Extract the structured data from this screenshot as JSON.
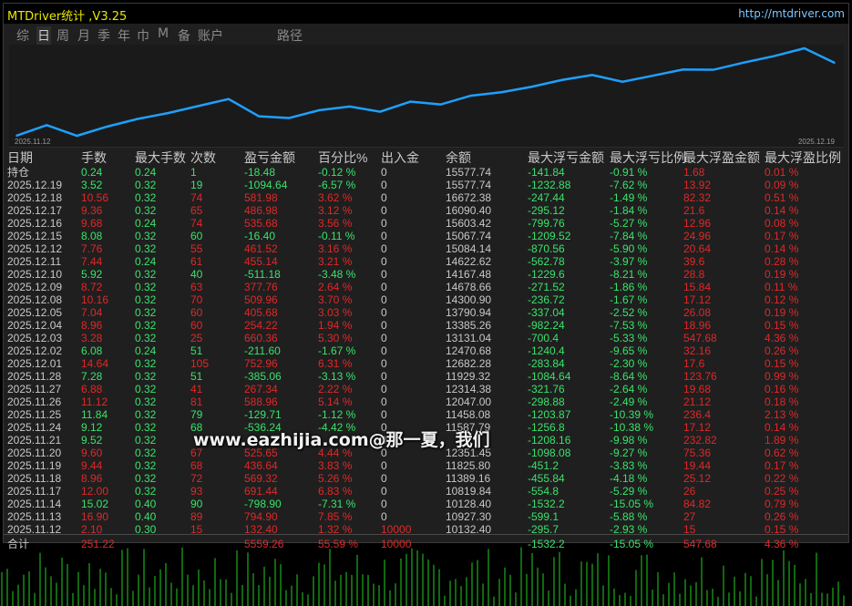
{
  "app": {
    "title": "MTDriver统计 ,V3.25",
    "url": "http://mtdriver.com"
  },
  "tabs": [
    "综",
    "日",
    "周",
    "月",
    "季",
    "年",
    "巾",
    "M",
    "备",
    "账户",
    "路径"
  ],
  "active_tab": "日",
  "chart_data": {
    "type": "line",
    "x_start_label": "2025.11.12",
    "x_end_label": "2025.12.19",
    "series": [
      {
        "values": [
          10132.4,
          10927.3,
          10128.4,
          10819.84,
          11389.16,
          11825.8,
          12351.45,
          12876.97,
          11587.79,
          11458.08,
          12047.0,
          12314.38,
          11929.32,
          12682.28,
          12470.68,
          13131.04,
          13385.26,
          13790.94,
          14300.9,
          14678.66,
          14167.48,
          14622.62,
          15084.14,
          15067.74,
          15603.42,
          16090.4,
          16672.38,
          15577.74
        ]
      }
    ],
    "color": "#1ea0ff"
  },
  "table": {
    "columns": [
      "日期",
      "手数",
      "最大手数",
      "次数",
      "盈亏金额",
      "百分比%",
      "出入金",
      "余额",
      "最大浮亏金额",
      "最大浮亏比例",
      "最大浮盈金额",
      "最大浮盈比例"
    ],
    "rows": [
      {
        "date": "持仓",
        "lots": "0.24",
        "max_lots": "0.24",
        "count": "1",
        "pnl": "-18.48",
        "pct": "-0.12 %",
        "flow": "0",
        "balance": "15577.74",
        "max_dd": "-141.84",
        "max_dd_pct": "-0.91 %",
        "max_fp": "1.68",
        "max_fp_pct": "0.01 %",
        "color": "green"
      },
      {
        "date": "2025.12.19",
        "lots": "3.52",
        "max_lots": "0.32",
        "count": "19",
        "pnl": "-1094.64",
        "pct": "-6.57 %",
        "flow": "0",
        "balance": "15577.74",
        "max_dd": "-1232.88",
        "max_dd_pct": "-7.62 %",
        "max_fp": "13.92",
        "max_fp_pct": "0.09 %",
        "color": "green"
      },
      {
        "date": "2025.12.18",
        "lots": "10.56",
        "max_lots": "0.32",
        "count": "74",
        "pnl": "581.98",
        "pct": "3.62 %",
        "flow": "0",
        "balance": "16672.38",
        "max_dd": "-247.44",
        "max_dd_pct": "-1.49 %",
        "max_fp": "82.32",
        "max_fp_pct": "0.51 %",
        "color": "red"
      },
      {
        "date": "2025.12.17",
        "lots": "9.36",
        "max_lots": "0.32",
        "count": "65",
        "pnl": "486.98",
        "pct": "3.12 %",
        "flow": "0",
        "balance": "16090.40",
        "max_dd": "-295.12",
        "max_dd_pct": "-1.84 %",
        "max_fp": "21.6",
        "max_fp_pct": "0.14 %",
        "color": "red"
      },
      {
        "date": "2025.12.16",
        "lots": "9.68",
        "max_lots": "0.24",
        "count": "74",
        "pnl": "535.68",
        "pct": "3.56 %",
        "flow": "0",
        "balance": "15603.42",
        "max_dd": "-799.76",
        "max_dd_pct": "-5.27 %",
        "max_fp": "12.96",
        "max_fp_pct": "0.08 %",
        "color": "red"
      },
      {
        "date": "2025.12.15",
        "lots": "8.08",
        "max_lots": "0.32",
        "count": "60",
        "pnl": "-16.40",
        "pct": "-0.11 %",
        "flow": "0",
        "balance": "15067.74",
        "max_dd": "-1209.52",
        "max_dd_pct": "-7.84 %",
        "max_fp": "24.96",
        "max_fp_pct": "0.17 %",
        "color": "green"
      },
      {
        "date": "2025.12.12",
        "lots": "7.76",
        "max_lots": "0.32",
        "count": "55",
        "pnl": "461.52",
        "pct": "3.16 %",
        "flow": "0",
        "balance": "15084.14",
        "max_dd": "-870.56",
        "max_dd_pct": "-5.90 %",
        "max_fp": "20.64",
        "max_fp_pct": "0.14 %",
        "color": "red"
      },
      {
        "date": "2025.12.11",
        "lots": "7.44",
        "max_lots": "0.24",
        "count": "61",
        "pnl": "455.14",
        "pct": "3.21 %",
        "flow": "0",
        "balance": "14622.62",
        "max_dd": "-562.78",
        "max_dd_pct": "-3.97 %",
        "max_fp": "39.6",
        "max_fp_pct": "0.28 %",
        "color": "red"
      },
      {
        "date": "2025.12.10",
        "lots": "5.92",
        "max_lots": "0.32",
        "count": "40",
        "pnl": "-511.18",
        "pct": "-3.48 %",
        "flow": "0",
        "balance": "14167.48",
        "max_dd": "-1229.6",
        "max_dd_pct": "-8.21 %",
        "max_fp": "28.8",
        "max_fp_pct": "0.19 %",
        "color": "green"
      },
      {
        "date": "2025.12.09",
        "lots": "8.72",
        "max_lots": "0.32",
        "count": "63",
        "pnl": "377.76",
        "pct": "2.64 %",
        "flow": "0",
        "balance": "14678.66",
        "max_dd": "-271.52",
        "max_dd_pct": "-1.86 %",
        "max_fp": "15.84",
        "max_fp_pct": "0.11 %",
        "color": "red"
      },
      {
        "date": "2025.12.08",
        "lots": "10.16",
        "max_lots": "0.32",
        "count": "70",
        "pnl": "509.96",
        "pct": "3.70 %",
        "flow": "0",
        "balance": "14300.90",
        "max_dd": "-236.72",
        "max_dd_pct": "-1.67 %",
        "max_fp": "17.12",
        "max_fp_pct": "0.12 %",
        "color": "red"
      },
      {
        "date": "2025.12.05",
        "lots": "7.04",
        "max_lots": "0.32",
        "count": "60",
        "pnl": "405.68",
        "pct": "3.03 %",
        "flow": "0",
        "balance": "13790.94",
        "max_dd": "-337.04",
        "max_dd_pct": "-2.52 %",
        "max_fp": "26.08",
        "max_fp_pct": "0.19 %",
        "color": "red"
      },
      {
        "date": "2025.12.04",
        "lots": "8.96",
        "max_lots": "0.32",
        "count": "60",
        "pnl": "254.22",
        "pct": "1.94 %",
        "flow": "0",
        "balance": "13385.26",
        "max_dd": "-982.24",
        "max_dd_pct": "-7.53 %",
        "max_fp": "18.96",
        "max_fp_pct": "0.15 %",
        "color": "red"
      },
      {
        "date": "2025.12.03",
        "lots": "3.28",
        "max_lots": "0.32",
        "count": "25",
        "pnl": "660.36",
        "pct": "5.30 %",
        "flow": "0",
        "balance": "13131.04",
        "max_dd": "-700.4",
        "max_dd_pct": "-5.33 %",
        "max_fp": "547.68",
        "max_fp_pct": "4.36 %",
        "color": "red"
      },
      {
        "date": "2025.12.02",
        "lots": "6.08",
        "max_lots": "0.24",
        "count": "51",
        "pnl": "-211.60",
        "pct": "-1.67 %",
        "flow": "0",
        "balance": "12470.68",
        "max_dd": "-1240.4",
        "max_dd_pct": "-9.65 %",
        "max_fp": "32.16",
        "max_fp_pct": "0.26 %",
        "color": "green"
      },
      {
        "date": "2025.12.01",
        "lots": "14.64",
        "max_lots": "0.32",
        "count": "105",
        "pnl": "752.96",
        "pct": "6.31 %",
        "flow": "0",
        "balance": "12682.28",
        "max_dd": "-283.84",
        "max_dd_pct": "-2.30 %",
        "max_fp": "17.6",
        "max_fp_pct": "0.15 %",
        "color": "red"
      },
      {
        "date": "2025.11.28",
        "lots": "7.28",
        "max_lots": "0.32",
        "count": "51",
        "pnl": "-385.06",
        "pct": "-3.13 %",
        "flow": "0",
        "balance": "11929.32",
        "max_dd": "-1084.64",
        "max_dd_pct": "-8.64 %",
        "max_fp": "123.76",
        "max_fp_pct": "0.99 %",
        "color": "green"
      },
      {
        "date": "2025.11.27",
        "lots": "6.88",
        "max_lots": "0.32",
        "count": "41",
        "pnl": "267.34",
        "pct": "2.22 %",
        "flow": "0",
        "balance": "12314.38",
        "max_dd": "-321.76",
        "max_dd_pct": "-2.64 %",
        "max_fp": "19.68",
        "max_fp_pct": "0.16 %",
        "color": "red"
      },
      {
        "date": "2025.11.26",
        "lots": "11.12",
        "max_lots": "0.32",
        "count": "81",
        "pnl": "588.96",
        "pct": "5.14 %",
        "flow": "0",
        "balance": "12047.00",
        "max_dd": "-298.88",
        "max_dd_pct": "-2.49 %",
        "max_fp": "21.12",
        "max_fp_pct": "0.18 %",
        "color": "red"
      },
      {
        "date": "2025.11.25",
        "lots": "11.84",
        "max_lots": "0.32",
        "count": "79",
        "pnl": "-129.71",
        "pct": "-1.12 %",
        "flow": "0",
        "balance": "11458.08",
        "max_dd": "-1203.87",
        "max_dd_pct": "-10.39 %",
        "max_fp": "236.4",
        "max_fp_pct": "2.13 %",
        "color": "green"
      },
      {
        "date": "2025.11.24",
        "lots": "9.12",
        "max_lots": "0.32",
        "count": "68",
        "pnl": "-536.24",
        "pct": "-4.42 %",
        "flow": "0",
        "balance": "11587.79",
        "max_dd": "-1256.8",
        "max_dd_pct": "-10.38 %",
        "max_fp": "17.12",
        "max_fp_pct": "0.14 %",
        "color": "green"
      },
      {
        "date": "2025.11.21",
        "lots": "9.52",
        "max_lots": "0.32",
        "count": "",
        "pnl": "",
        "pct": "",
        "flow": "0",
        "balance": "",
        "max_dd": "-1208.16",
        "max_dd_pct": "-9.98 %",
        "max_fp": "232.82",
        "max_fp_pct": "1.89 %",
        "color": "green"
      },
      {
        "date": "2025.11.20",
        "lots": "9.60",
        "max_lots": "0.32",
        "count": "67",
        "pnl": "525.65",
        "pct": "4.44 %",
        "flow": "0",
        "balance": "12351.45",
        "max_dd": "-1098.08",
        "max_dd_pct": "-9.27 %",
        "max_fp": "75.36",
        "max_fp_pct": "0.62 %",
        "color": "red"
      },
      {
        "date": "2025.11.19",
        "lots": "9.44",
        "max_lots": "0.32",
        "count": "68",
        "pnl": "436.64",
        "pct": "3.83 %",
        "flow": "0",
        "balance": "11825.80",
        "max_dd": "-451.2",
        "max_dd_pct": "-3.83 %",
        "max_fp": "19.44",
        "max_fp_pct": "0.17 %",
        "color": "red"
      },
      {
        "date": "2025.11.18",
        "lots": "8.96",
        "max_lots": "0.32",
        "count": "72",
        "pnl": "569.32",
        "pct": "5.26 %",
        "flow": "0",
        "balance": "11389.16",
        "max_dd": "-455.84",
        "max_dd_pct": "-4.18 %",
        "max_fp": "25.12",
        "max_fp_pct": "0.22 %",
        "color": "red"
      },
      {
        "date": "2025.11.17",
        "lots": "12.00",
        "max_lots": "0.32",
        "count": "93",
        "pnl": "691.44",
        "pct": "6.83 %",
        "flow": "0",
        "balance": "10819.84",
        "max_dd": "-554.8",
        "max_dd_pct": "-5.29 %",
        "max_fp": "26",
        "max_fp_pct": "0.25 %",
        "color": "red"
      },
      {
        "date": "2025.11.14",
        "lots": "15.02",
        "max_lots": "0.40",
        "count": "90",
        "pnl": "-798.90",
        "pct": "-7.31 %",
        "flow": "0",
        "balance": "10128.40",
        "max_dd": "-1532.2",
        "max_dd_pct": "-15.05 %",
        "max_fp": "84.82",
        "max_fp_pct": "0.79 %",
        "color": "green"
      },
      {
        "date": "2025.11.13",
        "lots": "16.90",
        "max_lots": "0.40",
        "count": "89",
        "pnl": "794.90",
        "pct": "7.85 %",
        "flow": "0",
        "balance": "10927.30",
        "max_dd": "-599.1",
        "max_dd_pct": "-5.88 %",
        "max_fp": "27",
        "max_fp_pct": "0.26 %",
        "color": "red"
      },
      {
        "date": "2025.11.12",
        "lots": "2.10",
        "max_lots": "0.30",
        "count": "15",
        "pnl": "132.40",
        "pct": "1.32 %",
        "flow": "10000",
        "balance": "10132.40",
        "max_dd": "-295.7",
        "max_dd_pct": "-2.93 %",
        "max_fp": "15",
        "max_fp_pct": "0.15 %",
        "color": "red"
      }
    ],
    "total": {
      "label": "合计",
      "lots": "251.22",
      "pnl": "5559.26",
      "pct": "55.59 %",
      "flow": "10000",
      "max_dd": "-1532.2",
      "max_dd_pct": "-15.05 %",
      "max_fp": "547.68",
      "max_fp_pct": "4.36 %"
    }
  },
  "watermark": "www.eazhijia.com@那一夏，我们",
  "colors": {
    "green": "#39e36a",
    "red": "#e02828",
    "line": "#1ea0ff",
    "title": "#e8e800",
    "url": "#7fc8ff"
  }
}
